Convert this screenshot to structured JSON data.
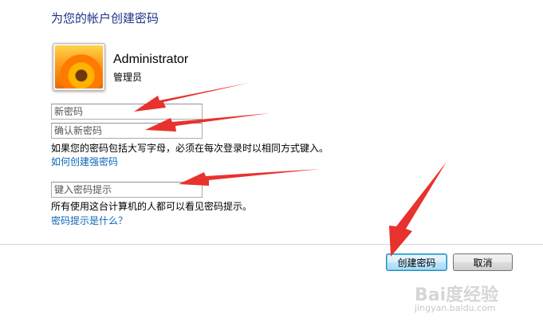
{
  "header": {
    "title": "为您的帐户创建密码"
  },
  "user": {
    "name": "Administrator",
    "role": "管理员"
  },
  "form": {
    "new_password_placeholder": "新密码",
    "confirm_password_placeholder": "确认新密码",
    "case_note": "如果您的密码包括大写字母，必须在每次登录时以相同方式键入。",
    "strong_password_link": "如何创建强密码",
    "hint_placeholder": "键入密码提示",
    "hint_note": "所有使用这台计算机的人都可以看见密码提示。",
    "hint_help_link": "密码提示是什么？"
  },
  "buttons": {
    "create_label": "创建密码",
    "cancel_label": "取消"
  },
  "watermark": {
    "logo_text": "Bai度经验",
    "url": "jingyan.baidu.com"
  },
  "colors": {
    "title": "#1e3287",
    "link": "#0d65b7",
    "annotation_arrow": "#e8322d"
  }
}
